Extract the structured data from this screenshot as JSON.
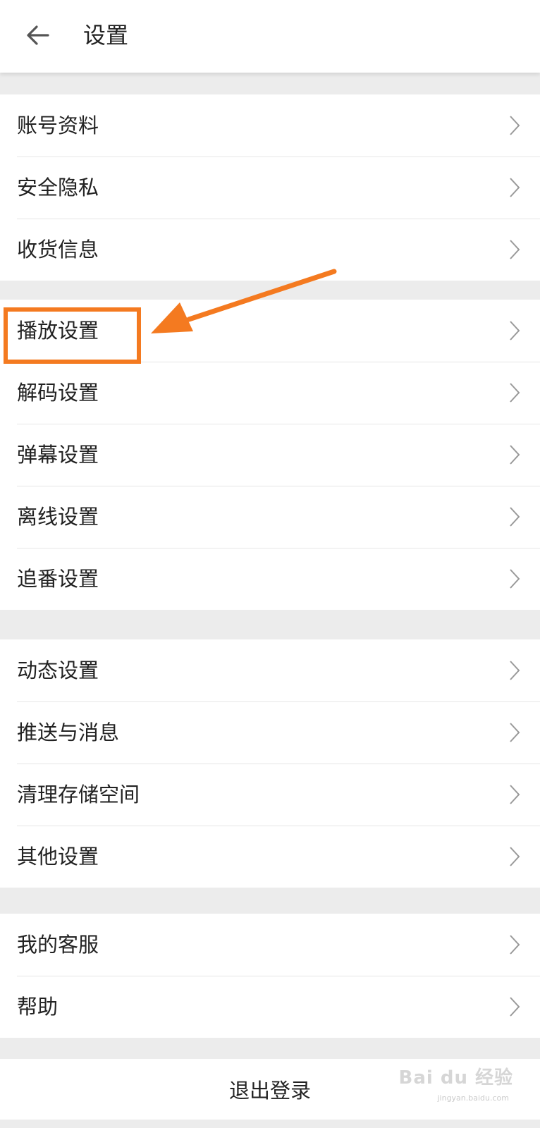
{
  "header": {
    "title": "设置",
    "back_icon": "arrow-left-icon"
  },
  "groups": [
    {
      "items": [
        {
          "label": "账号资料"
        },
        {
          "label": "安全隐私"
        },
        {
          "label": "收货信息"
        }
      ]
    },
    {
      "items": [
        {
          "label": "播放设置"
        },
        {
          "label": "解码设置"
        },
        {
          "label": "弹幕设置"
        },
        {
          "label": "离线设置"
        },
        {
          "label": "追番设置"
        }
      ]
    },
    {
      "items": [
        {
          "label": "动态设置"
        },
        {
          "label": "推送与消息"
        },
        {
          "label": "清理存储空间"
        },
        {
          "label": "其他设置"
        }
      ]
    },
    {
      "items": [
        {
          "label": "我的客服"
        },
        {
          "label": "帮助"
        }
      ]
    }
  ],
  "logout": {
    "label": "退出登录"
  },
  "annotation": {
    "highlighted_item": "播放设置",
    "color": "#f47a20"
  },
  "watermark": {
    "text": "Bai du 经验",
    "sub": "jingyan.baidu.com"
  }
}
